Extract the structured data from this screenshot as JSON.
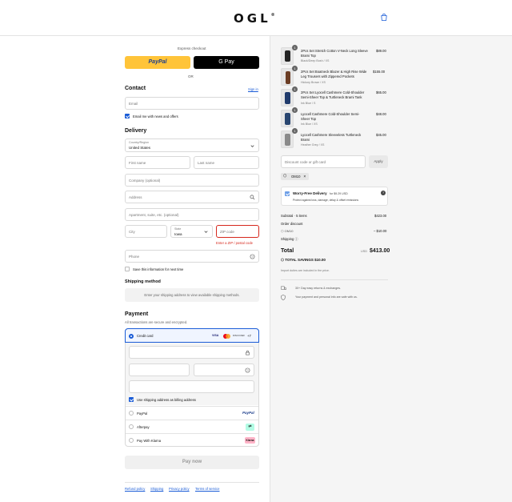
{
  "header": {
    "logo": "OGL",
    "logo_mark": "®"
  },
  "checkout": {
    "express_label": "Express checkout",
    "paypal_label": "PayPal",
    "gpay_label": "G Pay",
    "or_label": "OR",
    "contact_heading": "Contact",
    "sign_in": "Sign in",
    "email_placeholder": "Email",
    "email_news": "Email me with news and offers",
    "delivery_heading": "Delivery",
    "country_label": "Country/Region",
    "country_value": "United States",
    "first_name": "First name",
    "last_name": "Last name",
    "company": "Company (optional)",
    "address": "Address",
    "apartment": "Apartment, suite, etc. (optional)",
    "city": "City",
    "state_label": "State",
    "state_value": "Iowa",
    "zip": "ZIP code",
    "zip_error": "Enter a ZIP / postal code",
    "phone": "Phone",
    "save_info": "Save this information for next time",
    "shipping_heading": "Shipping method",
    "shipping_hint": "Enter your shipping address to view available shipping methods.",
    "payment_heading": "Payment",
    "payment_sub": "All transactions are secure and encrypted.",
    "credit_card": "Credit card",
    "card_more": "+7",
    "card_brands": [
      "VISA",
      "mastercard",
      "DISCOVER"
    ],
    "billing_same": "Use shipping address as billing address",
    "paypal": "PayPal",
    "afterpay": "Afterpay",
    "klarna": "Pay With Klarna",
    "paypal_badge": "PayPal",
    "klarna_badge": "Klarna",
    "pay_now": "Pay now",
    "footer_links": [
      "Refund policy",
      "Shipping",
      "Privacy policy",
      "Terms of service"
    ]
  },
  "summary": {
    "items": [
      {
        "qty": "1",
        "name": "2Pcs Set Stretch Cotton V-Neck Long Sleeve Brami Top",
        "variant": "Black/Deep Bush / XS",
        "price": "$89.00"
      },
      {
        "qty": "1",
        "name": "2Pcs Set Boatneck Blazer & High Rise Wide Leg Trousers with Zippered Pockets",
        "variant": "Hickory Brown / XS",
        "price": "$155.00"
      },
      {
        "qty": "1",
        "name": "2Pcs Set Lyocell Cashmere Cold-Shoulder Semi-Sheer Top & Turtleneck Brami Tank",
        "variant": "Ink Blue / S",
        "price": "$65.00"
      },
      {
        "qty": "1",
        "name": "Lyocell Cashmere Cold-Shoulder Semi-Sheer Top",
        "variant": "Ink Blue / XS",
        "price": "$48.00"
      },
      {
        "qty": "1",
        "name": "Lyocell Cashmere Sleeveless Turtleneck Brami",
        "variant": "Heather Grey / XS",
        "price": "$45.00"
      }
    ],
    "discount_placeholder": "Discount code or gift card",
    "apply": "Apply",
    "code_tag": "OM10",
    "worry_title": "Worry-Free Delivery",
    "worry_price": "for $9.29 USD",
    "worry_sub": "Protect against loss, damage, delay & offset emissions",
    "subtotal_label": "Subtotal · 5 items",
    "subtotal_value": "$423.00",
    "order_discount": "Order discount",
    "discount_code": "OM10",
    "discount_value": "– $10.00",
    "shipping_label": "Shipping",
    "total_label": "Total",
    "currency": "USD",
    "total_value": "$413.00",
    "savings_label": "TOTAL SAVINGS",
    "savings_value": "$10.00",
    "duties": "Import duties are included in the price.",
    "returns": "30+ Day easy returns & exchanges.",
    "secure": "Your payment and personal info are safe with us."
  },
  "colors": {
    "accent": "#1a5cd7",
    "paypal": "#ffc439",
    "error": "#d6281d"
  }
}
